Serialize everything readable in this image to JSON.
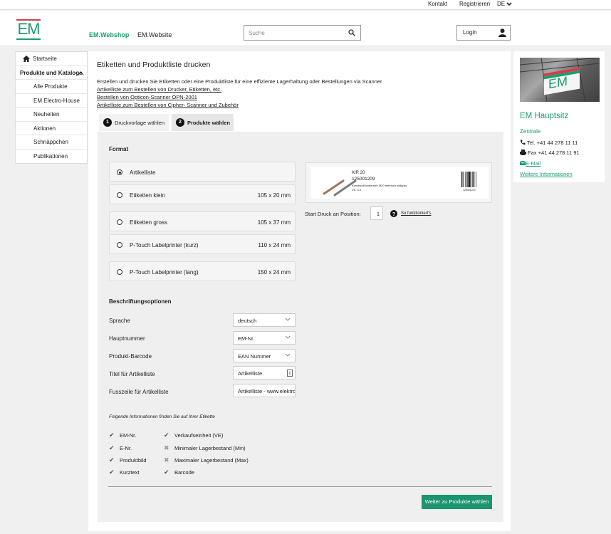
{
  "topbar": {
    "contact": "Kontakt",
    "register": "Registrieren",
    "language": "DE"
  },
  "header": {
    "logo_text": "EM",
    "nav_webshop": "EM.Webshop",
    "nav_website": "EM.Website",
    "search_placeholder": "Suche",
    "login_label": "Login"
  },
  "colors": {
    "brand_green": "#1a9e6e",
    "brand_red": "#d33c4c"
  },
  "sidebar": {
    "home": "Startseite",
    "products_section": "Produkte und Kataloge",
    "items": [
      "Alle Produkte",
      "EM Electro-House",
      "Neuheiten",
      "Aktionen",
      "Schnäppchen",
      "Publikationen"
    ]
  },
  "main": {
    "title": "Etiketten und Produktliste drucken",
    "intro": "Erstellen und drucken Sie Etiketten oder eine Produktliste für eine effiziente Lagerhaltung oder Bestellungen via Scanner.",
    "links": [
      "Artikelliste zum Bestellen von Drucker, Etiketten, etc.",
      "Bestellen von Opticon-Scanner OPN-2001",
      "Artikelliste zum Bestellen von Cipher- Scanner und Zubehör"
    ],
    "tabs": [
      {
        "num": "1",
        "label": "Druckvorlage wählen"
      },
      {
        "num": "2",
        "label": "Produkte wählen"
      }
    ],
    "format_heading": "Format",
    "formats": [
      {
        "label": "Artikelliste",
        "size": "",
        "selected": true
      },
      {
        "label": "Etiketten klein",
        "size": "105 x 20 mm",
        "selected": false
      },
      {
        "label": "Etiketten gross",
        "size": "105 x 37 mm",
        "selected": false
      },
      {
        "label": "P-Touch Labelprinter (kurz)",
        "size": "110 x 24 mm",
        "selected": false
      },
      {
        "label": "P-Touch Labelprinter (lang)",
        "size": "150 x 24 mm",
        "selected": false
      }
    ],
    "preview": {
      "article": "KIR 20",
      "number": "125001209",
      "desc": "Kunststoff-Isolierrohr M20 metrisch hellgrau",
      "ve": "VE: 3.0",
      "barcode_num": "125001209"
    },
    "start_position_label": "Start Druck an Position:",
    "start_position_value": "1",
    "how_it_works": "So funktioniert's",
    "options_heading": "Beschriftungsoptionen",
    "options": {
      "language_label": "Sprache",
      "language_value": "deutsch",
      "mainnum_label": "Hauptnummer",
      "mainnum_value": "EM-Nr.",
      "barcode_label": "Produkt-Barcode",
      "barcode_value": "EAN Nummer",
      "title_label": "Titel für Artikelliste",
      "title_value": "Artikelliste",
      "footer_label": "Fusszeile für Artikelliste",
      "footer_value": "Artikelliste - www.elektro-material.ch"
    },
    "info_heading": "Folgende Informationen finden Sie auf Ihrer Etikette",
    "info_left": [
      "EM-Nr.",
      "E-Nr.",
      "Produktbild",
      "Kurztext"
    ],
    "info_right": [
      {
        "label": "Verkaufseinheit (VE)",
        "included": true
      },
      {
        "label": "Minimaler Lagerbestand (Min)",
        "included": false
      },
      {
        "label": "Maximaler Lagerbestand (Max)",
        "included": false
      },
      {
        "label": "Barcode",
        "included": true
      }
    ],
    "next_button": "Weiter zu Produkte wählen"
  },
  "card": {
    "title": "EM Hauptsitz",
    "subtitle": "Zentrale",
    "tel": "Tel. +41 44 278 11 11",
    "fax": "Fax +41 44 278 11 91",
    "email": "E-Mail",
    "more": "Weitere Informationen"
  }
}
